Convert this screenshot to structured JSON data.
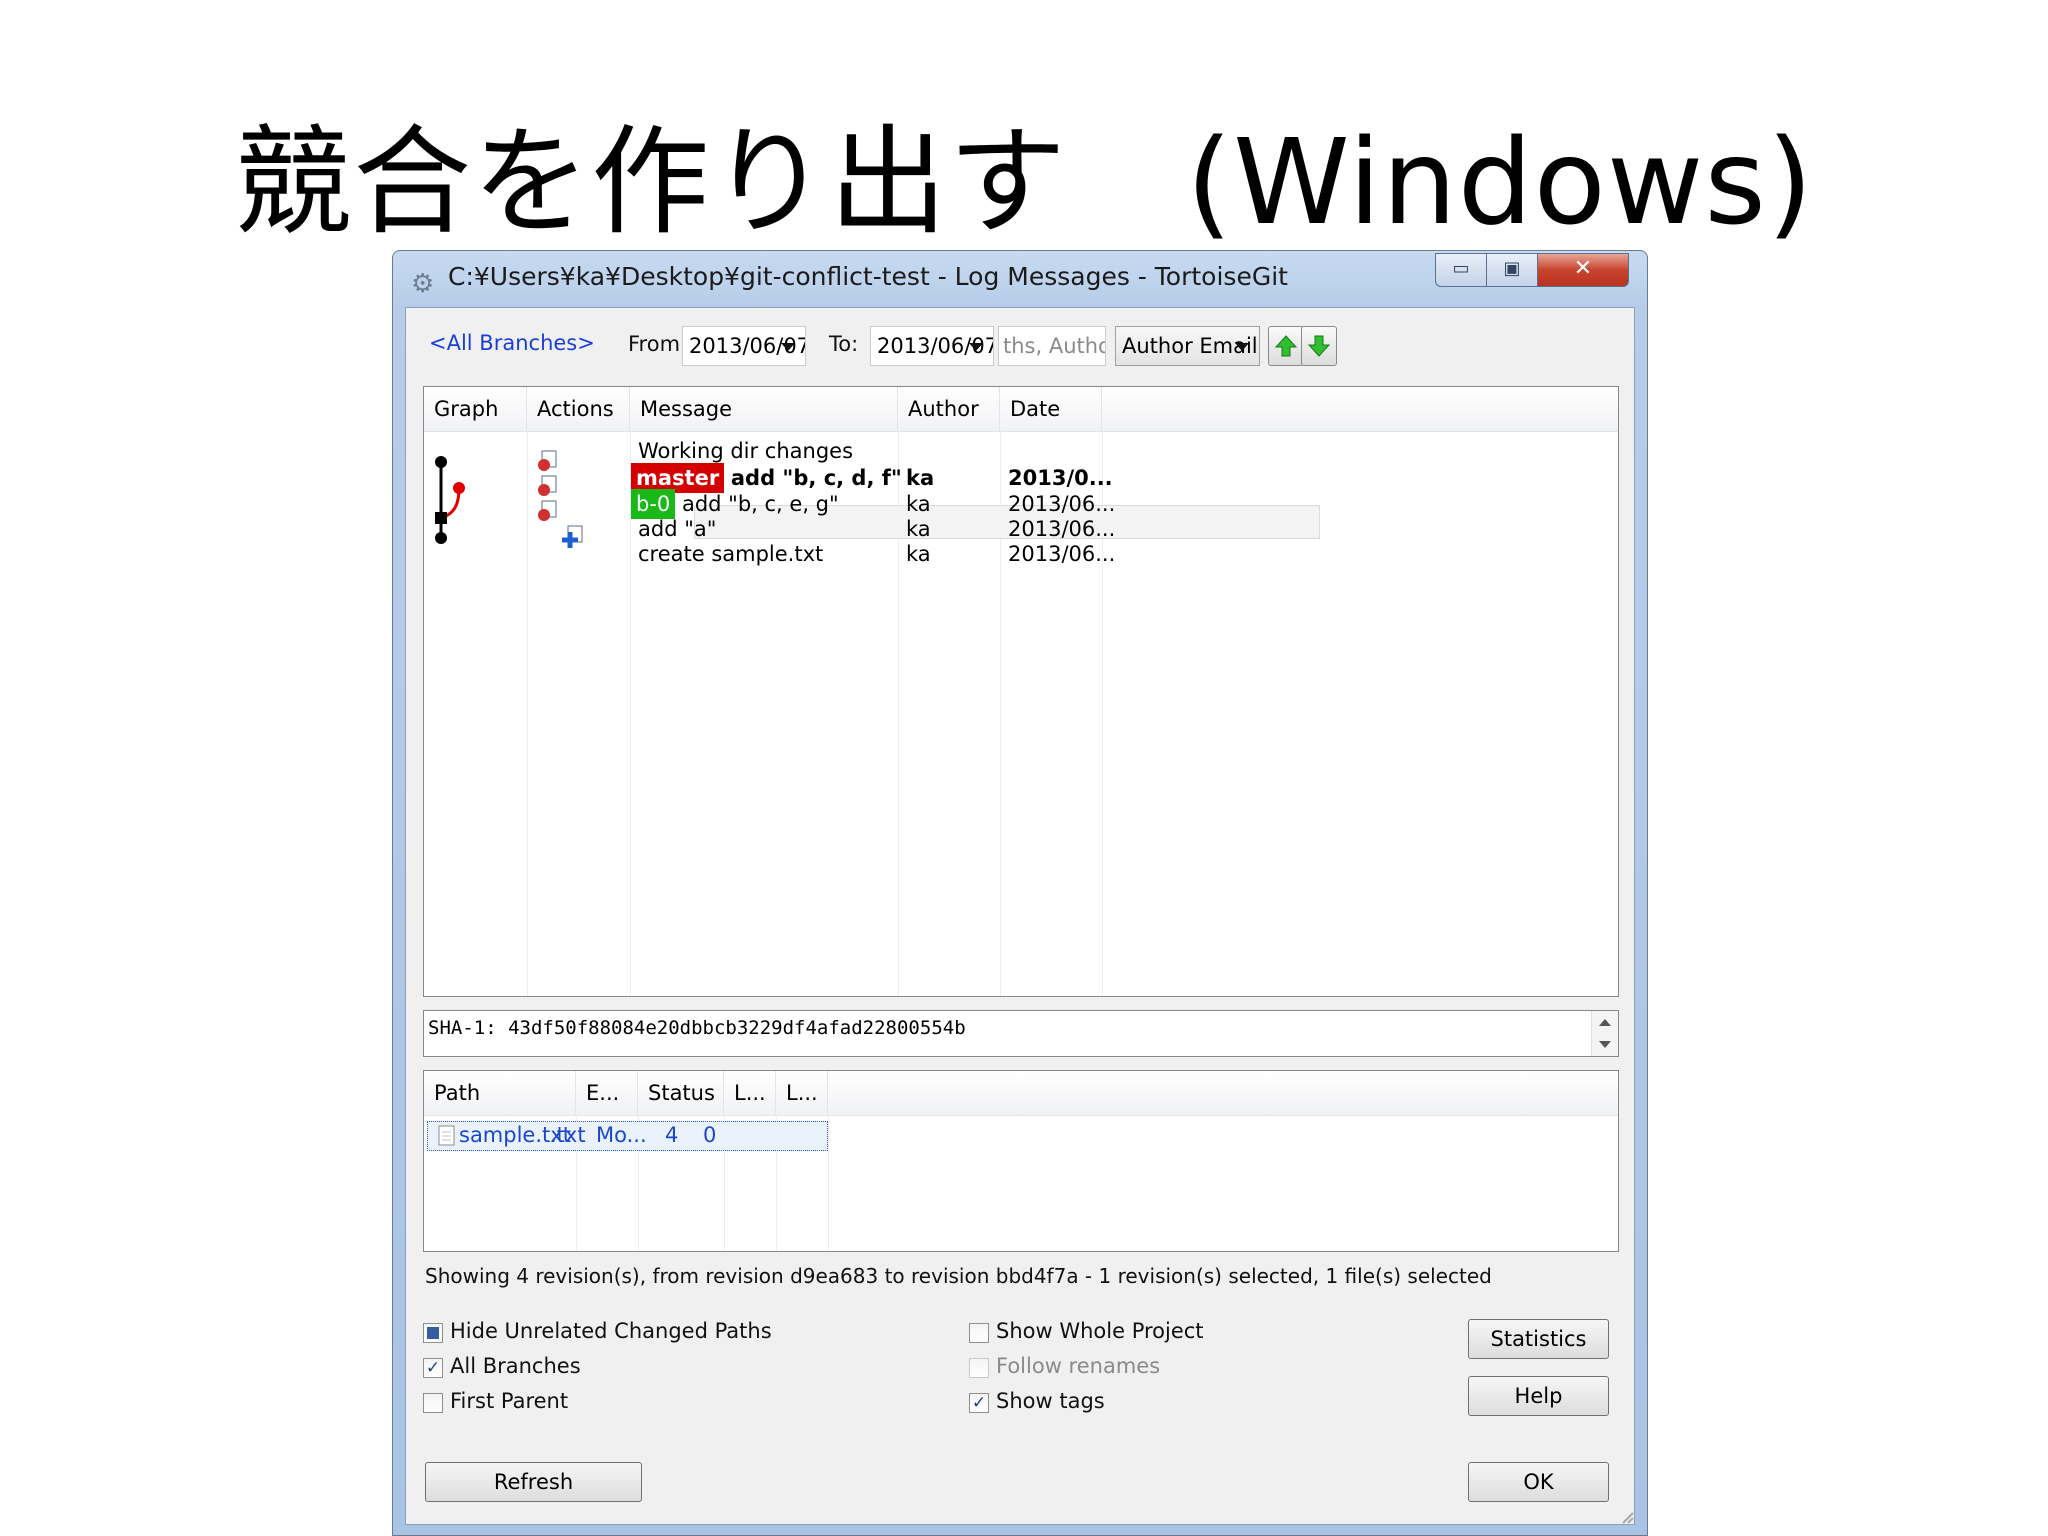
{
  "slide": {
    "title": "競合を作り出す　(Windows)"
  },
  "window": {
    "title": "C:¥Users¥ka¥Desktop¥git-conflict-test - Log Messages - TortoiseGit",
    "minimize_glyph": "▭",
    "maximize_glyph": "▣",
    "close_glyph": "✕"
  },
  "filters": {
    "branches_link": "<All Branches>",
    "from_label": "From:",
    "from_value": "2013/06/07",
    "to_label": "To:",
    "to_value": "2013/06/07",
    "search_placeholder": "ths, Authors, E",
    "search_mode": "Author Email"
  },
  "log": {
    "columns": [
      "Graph",
      "Actions",
      "Message",
      "Author",
      "Date"
    ],
    "working_dir": "Working dir changes",
    "rows": [
      {
        "ref": "master",
        "message": "add \"b, c, d, f\"",
        "author": "ka",
        "date": "2013/0...",
        "bold": true
      },
      {
        "ref": "b-0",
        "message": "add \"b, c, e, g\"",
        "author": "ka",
        "date": "2013/06...",
        "selected": true
      },
      {
        "ref": "",
        "message": "add \"a\"",
        "author": "ka",
        "date": "2013/06..."
      },
      {
        "ref": "",
        "message": "create sample.txt",
        "author": "ka",
        "date": "2013/06..."
      }
    ],
    "colors": {
      "master_tag": "#d40000",
      "branch_tag": "#19b919",
      "graph_branch": "#e00000"
    }
  },
  "sha": {
    "text": "SHA-1:  43df50f88084e20dbbcb3229df4afad22800554b"
  },
  "files": {
    "columns": [
      "Path",
      "E...",
      "Status",
      "L...",
      "L..."
    ],
    "rows": [
      {
        "path": "sample.txt",
        "ext": ".txt",
        "status": "Mo...",
        "added": "4",
        "removed": "0"
      }
    ]
  },
  "status_line": "Showing 4 revision(s), from revision d9ea683 to revision bbd4f7a - 1 revision(s) selected, 1 file(s) selected",
  "options": {
    "hide_unrelated": "Hide Unrelated Changed Paths",
    "all_branches": "All Branches",
    "first_parent": "First Parent",
    "show_whole_project": "Show Whole Project",
    "follow_renames": "Follow renames",
    "show_tags": "Show tags",
    "check_glyph": "✓"
  },
  "buttons": {
    "statistics": "Statistics",
    "help": "Help",
    "refresh": "Refresh",
    "ok": "OK"
  }
}
